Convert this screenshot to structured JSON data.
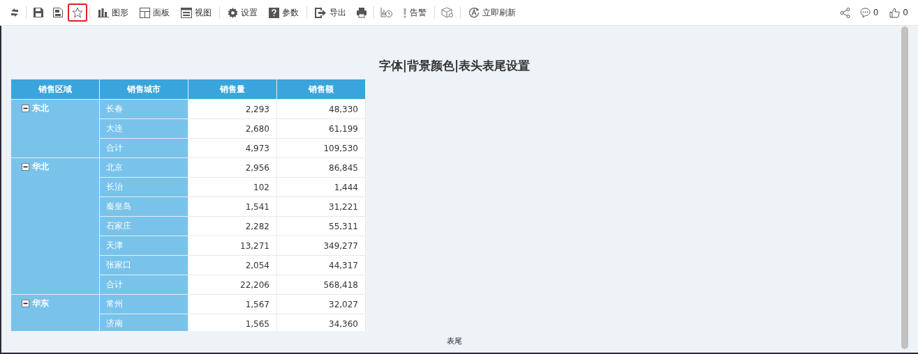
{
  "toolbar": {
    "items": [
      {
        "kind": "icon",
        "highlighted": false
      },
      {
        "kind": "divider"
      },
      {
        "kind": "icon",
        "highlighted": false
      },
      {
        "kind": "icon",
        "highlighted": false
      },
      {
        "kind": "icon",
        "highlighted": true
      },
      {
        "kind": "divider"
      },
      {
        "kind": "button",
        "label": "图形"
      },
      {
        "kind": "button",
        "label": "面板"
      },
      {
        "kind": "button",
        "label": "视图"
      },
      {
        "kind": "divider"
      },
      {
        "kind": "button",
        "label": "设置"
      },
      {
        "kind": "button",
        "label": "参数"
      },
      {
        "kind": "divider"
      },
      {
        "kind": "button",
        "label": "导出"
      },
      {
        "kind": "icon",
        "highlighted": false
      },
      {
        "kind": "divider"
      },
      {
        "kind": "icon",
        "highlighted": false
      },
      {
        "kind": "button",
        "label": "告警"
      },
      {
        "kind": "divider"
      },
      {
        "kind": "icon",
        "highlighted": false
      },
      {
        "kind": "divider"
      },
      {
        "kind": "button",
        "label": "立即刷新"
      }
    ],
    "right": [
      {
        "kind": "share"
      },
      {
        "kind": "comment",
        "count": "0"
      },
      {
        "kind": "like",
        "count": "0"
      }
    ]
  },
  "report": {
    "title": "字体|背景颜色|表头表尾设置",
    "table": {
      "columns": [
        "销售区域",
        "销售城市",
        "销售量",
        "销售额"
      ],
      "groups": [
        {
          "region": "东北",
          "expanded": true,
          "rows": [
            {
              "city": "长春",
              "quantity": "2,293",
              "amount": "48,330"
            },
            {
              "city": "大连",
              "quantity": "2,680",
              "amount": "61,199"
            },
            {
              "city": "合计",
              "quantity": "4,973",
              "amount": "109,530"
            }
          ]
        },
        {
          "region": "华北",
          "expanded": true,
          "rows": [
            {
              "city": "北京",
              "quantity": "2,956",
              "amount": "86,845"
            },
            {
              "city": "长治",
              "quantity": "102",
              "amount": "1,444"
            },
            {
              "city": "秦皇岛",
              "quantity": "1,541",
              "amount": "31,221"
            },
            {
              "city": "石家庄",
              "quantity": "2,282",
              "amount": "55,311"
            },
            {
              "city": "天津",
              "quantity": "13,271",
              "amount": "349,277"
            },
            {
              "city": "张家口",
              "quantity": "2,054",
              "amount": "44,317"
            },
            {
              "city": "合计",
              "quantity": "22,206",
              "amount": "568,418"
            }
          ]
        },
        {
          "region": "华东",
          "expanded": true,
          "rows": [
            {
              "city": "常州",
              "quantity": "1,567",
              "amount": "32,027"
            },
            {
              "city": "济南",
              "quantity": "1,565",
              "amount": "34,360"
            }
          ]
        }
      ]
    },
    "footer": "表尾"
  }
}
